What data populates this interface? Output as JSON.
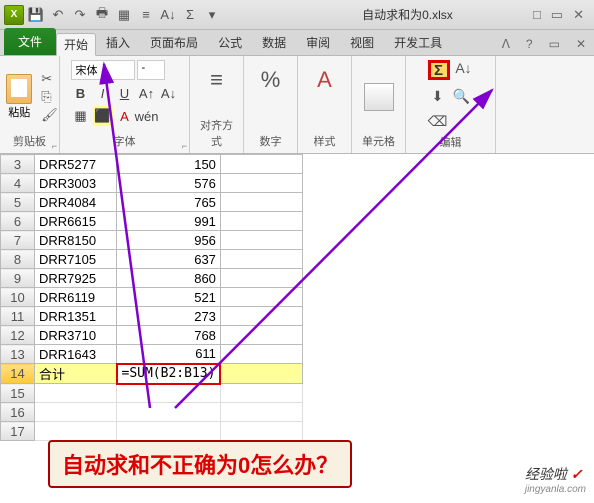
{
  "title": "自动求和为0.xlsx",
  "wctrl": {
    "min": "□",
    "help": "?",
    "restore": "▭",
    "close": "✕",
    "collapse": "ᐱ"
  },
  "tabs": {
    "file": "文件",
    "home": "开始",
    "insert": "插入",
    "layout": "页面布局",
    "formula": "公式",
    "data": "数据",
    "review": "审阅",
    "view": "视图",
    "dev": "开发工具"
  },
  "groups": {
    "clipboard": "剪贴板",
    "paste": "粘贴",
    "font": "字体",
    "fontname": "宋体",
    "align": "对齐方式",
    "number": "数字",
    "styles": "样式",
    "cells": "单元格",
    "editing": "编辑"
  },
  "rows": [
    {
      "n": 3,
      "a": "DRR5277",
      "b": "150"
    },
    {
      "n": 4,
      "a": "DRR3003",
      "b": "576"
    },
    {
      "n": 5,
      "a": "DRR4084",
      "b": "765"
    },
    {
      "n": 6,
      "a": "DRR6615",
      "b": "991"
    },
    {
      "n": 7,
      "a": "DRR8150",
      "b": "956"
    },
    {
      "n": 8,
      "a": "DRR7105",
      "b": "637"
    },
    {
      "n": 9,
      "a": "DRR7925",
      "b": "860"
    },
    {
      "n": 10,
      "a": "DRR6119",
      "b": "521"
    },
    {
      "n": 11,
      "a": "DRR1351",
      "b": "273"
    },
    {
      "n": 12,
      "a": "DRR3710",
      "b": "768"
    },
    {
      "n": 13,
      "a": "DRR1643",
      "b": "611"
    }
  ],
  "sumrow": {
    "n": 14,
    "a": "合计",
    "b": "=SUM(B2:B13)"
  },
  "blank": [
    15,
    16,
    17
  ],
  "callout": "自动求和不正确为0怎么办？",
  "watermark": {
    "main": "经验啦",
    "chk": "✓",
    "sub": "jingyanla.com"
  }
}
